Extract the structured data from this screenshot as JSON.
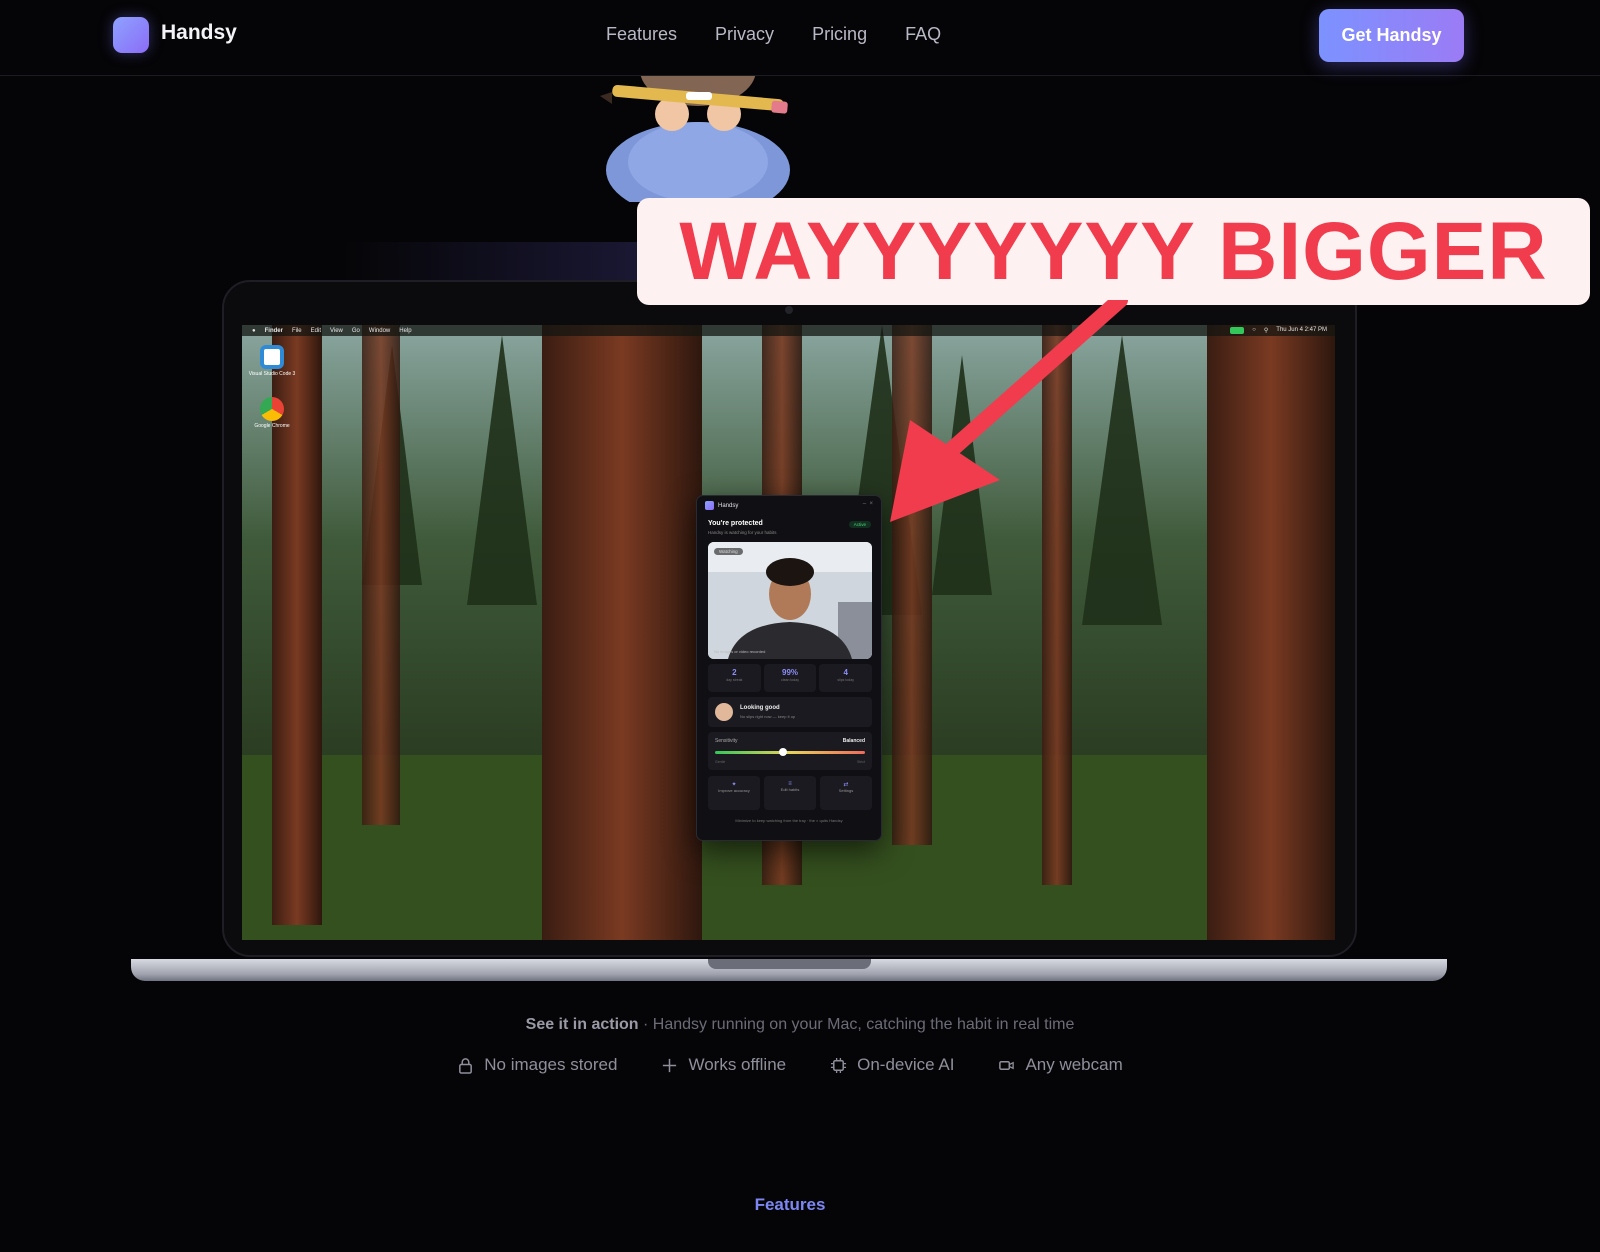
{
  "nav": {
    "brand": "Handsy",
    "links": [
      "Features",
      "Privacy",
      "Pricing",
      "FAQ"
    ],
    "cta": "Get Handsy"
  },
  "annotation": {
    "text": "WAYYYYYYY BIGGER",
    "color": "#f03c4d"
  },
  "desktop": {
    "menubar": {
      "app": "Finder",
      "menus": [
        "File",
        "Edit",
        "View",
        "Go",
        "Window",
        "Help"
      ],
      "clock": "Thu Jun 4  2:47 PM"
    },
    "icons": [
      {
        "label": "Visual Studio Code 3",
        "icon": "vscode-icon"
      },
      {
        "label": "Google Chrome",
        "icon": "chrome-icon"
      }
    ]
  },
  "app_window": {
    "title": "Handsy",
    "heading": "You're protected",
    "subheading": "Handsy is watching for your habits",
    "badge": "Active",
    "camera_tag": "Watching",
    "camera_note": "No images or video recorded",
    "stats": [
      {
        "value": "2",
        "label": "day streak"
      },
      {
        "value": "99%",
        "label": "clean today"
      },
      {
        "value": "4",
        "label": "slips today"
      }
    ],
    "status_title": "Looking good",
    "status_sub": "No slips right now — keep it up",
    "sensitivity_label": "Sensitivity",
    "sensitivity_value": "Balanced",
    "sensitivity_level": 0.45,
    "sensitivity_min": "Gentle",
    "sensitivity_max": "Strict",
    "actions": [
      "Improve accuracy",
      "Edit habits",
      "Settings"
    ],
    "footer": "Minimize to keep watching from the tray · the × quits Handsy"
  },
  "caption": {
    "lead": "See it in action",
    "rest": " · Handsy running on your Mac, catching the habit in real time"
  },
  "features": [
    {
      "icon": "lock-icon",
      "label": "No images stored"
    },
    {
      "icon": "plus-icon",
      "label": "Works offline"
    },
    {
      "icon": "chip-icon",
      "label": "On-device AI"
    },
    {
      "icon": "webcam-icon",
      "label": "Any webcam"
    }
  ],
  "section_label": "Features"
}
